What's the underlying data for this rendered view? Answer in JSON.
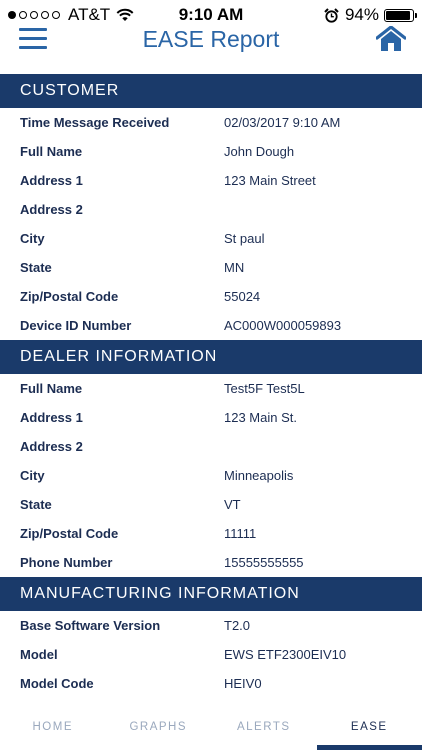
{
  "status_bar": {
    "carrier": "AT&T",
    "time": "9:10 AM",
    "battery_percent": "94%",
    "battery_level": 0.94,
    "signal_bars_filled": 1,
    "signal_bars_total": 5
  },
  "nav": {
    "title": "EASE Report",
    "menu_icon": "hamburger-menu-icon",
    "home_icon": "home-icon"
  },
  "colors": {
    "header_bg": "#1a3a6a",
    "accent": "#2a65a6",
    "text": "#1c2d52",
    "tab_inactive": "#9aa8bd"
  },
  "sections": {
    "customer": {
      "title": "CUSTOMER",
      "rows": [
        {
          "label": "Time Message Received",
          "value": "02/03/2017 9:10 AM"
        },
        {
          "label": "Full Name",
          "value": "John Dough"
        },
        {
          "label": "Address 1",
          "value": "123 Main Street"
        },
        {
          "label": "Address 2",
          "value": ""
        },
        {
          "label": "City",
          "value": "St paul"
        },
        {
          "label": "State",
          "value": "MN"
        },
        {
          "label": "Zip/Postal Code",
          "value": "55024"
        },
        {
          "label": "Device ID Number",
          "value": "AC000W000059893"
        }
      ]
    },
    "dealer": {
      "title": "DEALER INFORMATION",
      "rows": [
        {
          "label": "Full Name",
          "value": "Test5F Test5L"
        },
        {
          "label": "Address 1",
          "value": "123 Main St."
        },
        {
          "label": "Address 2",
          "value": ""
        },
        {
          "label": "City",
          "value": "Minneapolis"
        },
        {
          "label": "State",
          "value": "VT"
        },
        {
          "label": "Zip/Postal Code",
          "value": "11111"
        },
        {
          "label": "Phone Number",
          "value": "15555555555"
        }
      ]
    },
    "manufacturing": {
      "title": "MANUFACTURING INFORMATION",
      "rows": [
        {
          "label": "Base Software Version",
          "value": "T2.0"
        },
        {
          "label": "Model",
          "value": "EWS ETF2300EIV10"
        },
        {
          "label": "Model Code",
          "value": "HEIV0"
        }
      ]
    }
  },
  "tabs": [
    {
      "label": "HOME",
      "active": false
    },
    {
      "label": "GRAPHS",
      "active": false
    },
    {
      "label": "ALERTS",
      "active": false
    },
    {
      "label": "EASE",
      "active": true
    }
  ]
}
